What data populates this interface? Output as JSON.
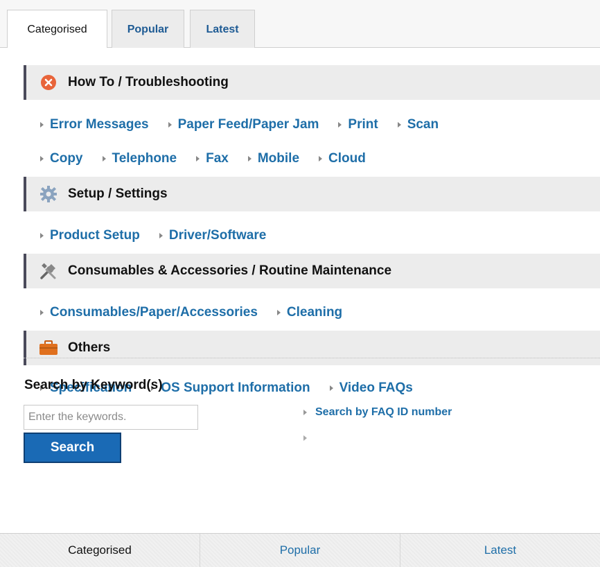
{
  "tabs": [
    {
      "label": "Categorised"
    },
    {
      "label": "Popular"
    },
    {
      "label": "Latest"
    }
  ],
  "sections": [
    {
      "title": "How To / Troubleshooting",
      "icon": "error-x-icon",
      "rows": [
        [
          "Error Messages",
          "Paper Feed/Paper Jam",
          "Print",
          "Scan"
        ],
        [
          "Copy",
          "Telephone",
          "Fax",
          "Mobile",
          "Cloud"
        ]
      ]
    },
    {
      "title": "Setup / Settings",
      "icon": "gear-icon",
      "rows": [
        [
          "Product Setup",
          "Driver/Software"
        ]
      ]
    },
    {
      "title": "Consumables & Accessories / Routine Maintenance",
      "icon": "tools-icon",
      "rows": [
        [
          "Consumables/Paper/Accessories",
          "Cleaning"
        ]
      ]
    },
    {
      "title": "Others",
      "icon": "toolbox-icon",
      "rows": [
        [
          "Specification",
          "OS Support Information",
          "Video FAQs"
        ]
      ]
    }
  ],
  "search": {
    "heading": "Search by Keyword(s)",
    "placeholder": "Enter the keywords.",
    "button_label": "Search",
    "faq_link": "Search by FAQ ID number"
  },
  "bottom_tabs": [
    {
      "label": "Categorised"
    },
    {
      "label": "Popular"
    },
    {
      "label": "Latest"
    }
  ],
  "colors": {
    "link": "#1e6ea8",
    "button": "#1a6ab5",
    "section_bg": "#ececec",
    "error_icon": "#e8643a",
    "toolbox_icon": "#e0701e"
  }
}
